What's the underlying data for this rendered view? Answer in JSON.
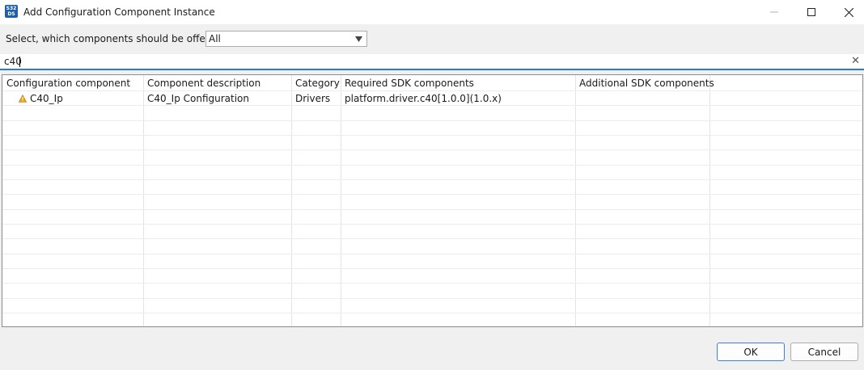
{
  "window": {
    "title": "Add Configuration Component Instance",
    "app_icon_text": "S32 DS"
  },
  "filter": {
    "label": "Select, which components should be offered",
    "selected": "All"
  },
  "search": {
    "value": "c40"
  },
  "table": {
    "columns": [
      "Configuration component",
      "Component description",
      "Category",
      "Required SDK components",
      "Additional SDK components"
    ],
    "rows": [
      {
        "component": "C40_Ip",
        "description": "C40_Ip Configuration",
        "category": "Drivers",
        "required_sdk": "platform.driver.c40[1.0.0](1.0.x)",
        "additional_sdk": "",
        "status_icon": "warning-icon"
      }
    ]
  },
  "buttons": {
    "ok": "OK",
    "cancel": "Cancel"
  },
  "colors": {
    "accent": "#2a7ad6",
    "warning": "#e8a317",
    "app_icon": "#1f5fa8"
  }
}
